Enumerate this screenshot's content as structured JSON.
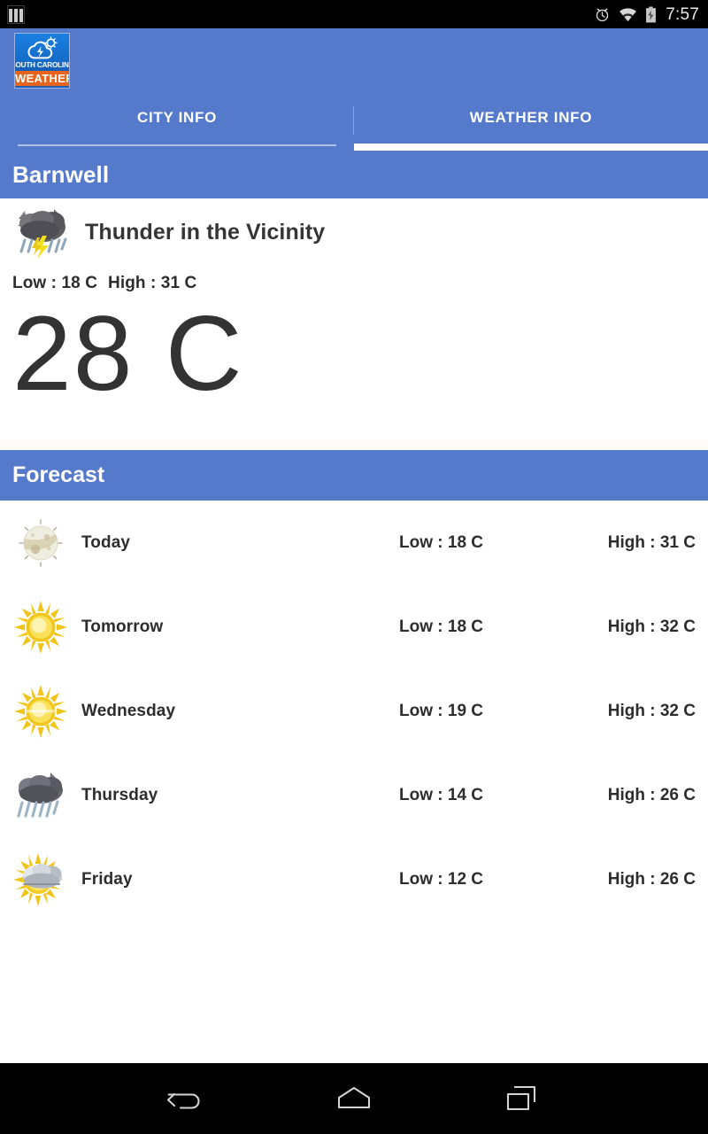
{
  "status_bar": {
    "sim_icon": "sim-card-icon",
    "alarm_icon": "alarm-clock-icon",
    "wifi_icon": "wifi-icon",
    "battery_icon": "battery-charging-icon",
    "time": "7:57"
  },
  "app_bar": {
    "logo_icon": "cloud-lightning-icon",
    "logo_line1": "SOUTH CAROLINA",
    "logo_line2": "WEATHER"
  },
  "tabs": [
    {
      "label": "CITY INFO",
      "active": false
    },
    {
      "label": "WEATHER INFO",
      "active": true
    }
  ],
  "city": {
    "name": "Barnwell"
  },
  "current": {
    "icon": "thunderstorm-icon",
    "condition": "Thunder in the Vicinity",
    "low": "Low : 18 C",
    "high": "High : 31 C",
    "temperature": "28 C"
  },
  "forecast": {
    "title": "Forecast",
    "rows": [
      {
        "icon": "full-moon-icon",
        "day": "Today",
        "low": "Low : 18 C",
        "high": "High : 31 C"
      },
      {
        "icon": "sun-icon",
        "day": "Tomorrow",
        "low": "Low : 18 C",
        "high": "High : 32 C"
      },
      {
        "icon": "sun-icon",
        "day": "Wednesday",
        "low": "Low : 19 C",
        "high": "High : 32 C"
      },
      {
        "icon": "rain-cloud-icon",
        "day": "Thursday",
        "low": "Low : 14 C",
        "high": "High : 26 C"
      },
      {
        "icon": "sun-behind-cloud-icon",
        "day": "Friday",
        "low": "Low : 12 C",
        "high": "High : 26 C"
      }
    ]
  },
  "nav_bar": {
    "back_icon": "back-arrow-icon",
    "home_icon": "home-icon",
    "recents_icon": "recent-apps-icon"
  },
  "colors": {
    "accent_blue": "#5579CB",
    "logo_orange": "#E8641C",
    "text_dark": "#2D2D2D",
    "background": "#FFFFFF",
    "navbar_black": "#000000"
  }
}
